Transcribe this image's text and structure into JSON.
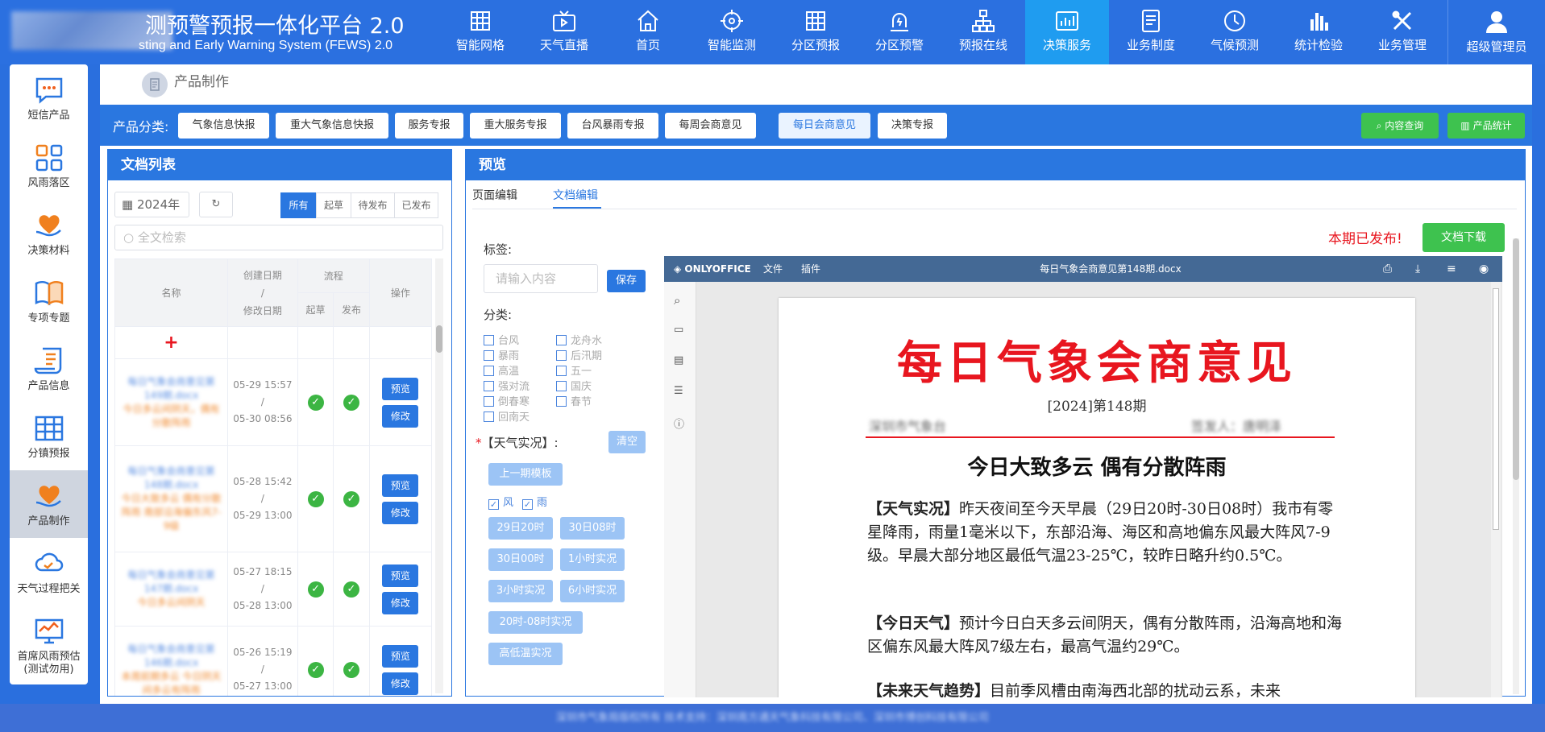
{
  "header": {
    "title": "测预警预报一体化平台 2.0",
    "subtitle": "sting and Early Warning System (FEWS) 2.0",
    "nav": [
      {
        "label": "智能网格",
        "icon": "grid-icon"
      },
      {
        "label": "天气直播",
        "icon": "video-icon"
      },
      {
        "label": "首页",
        "icon": "home-icon"
      },
      {
        "label": "智能监测",
        "icon": "target-icon"
      },
      {
        "label": "分区预报",
        "icon": "grid-icon"
      },
      {
        "label": "分区预警",
        "icon": "alarm-icon"
      },
      {
        "label": "预报在线",
        "icon": "org-icon"
      },
      {
        "label": "决策服务",
        "icon": "chart-icon"
      },
      {
        "label": "业务制度",
        "icon": "document-icon"
      },
      {
        "label": "气候预测",
        "icon": "clock-icon"
      },
      {
        "label": "统计检验",
        "icon": "bar-icon"
      },
      {
        "label": "业务管理",
        "icon": "tools-icon"
      }
    ],
    "user": "超级管理员"
  },
  "sidebar": [
    {
      "label": "短信产品",
      "icon": "message-icon"
    },
    {
      "label": "风雨落区",
      "icon": "apps-icon"
    },
    {
      "label": "决策材料",
      "icon": "heart-hand-icon"
    },
    {
      "label": "专项专题",
      "icon": "book-icon"
    },
    {
      "label": "产品信息",
      "icon": "scroll-icon"
    },
    {
      "label": "分镇预报",
      "icon": "table-icon"
    },
    {
      "label": "产品制作",
      "icon": "heart-hand-icon"
    },
    {
      "label": "天气过程把关",
      "icon": "cloud-icon"
    },
    {
      "label": "首席风雨预估",
      "label2": "(测试勿用)",
      "icon": "monitor-icon"
    }
  ],
  "breadcrumb": "产品制作",
  "categories": {
    "label": "产品分类:",
    "items": [
      "气象信息快报",
      "重大气象信息快报",
      "服务专报",
      "重大服务专报",
      "台风暴雨专报",
      "每周会商意见",
      "每日会商意见",
      "决策专报"
    ],
    "selected": "每日会商意见",
    "actions": [
      "内容查询",
      "产品统计"
    ]
  },
  "doclist": {
    "title": "文档列表",
    "year": "2024年",
    "search_placeholder": "全文检索",
    "filters": [
      "所有",
      "起草",
      "待发布",
      "已发布"
    ],
    "columns": {
      "name": "名称",
      "created": "创建日期",
      "sep": "/",
      "modified": "修改日期",
      "flow": "流程",
      "draft": "起草",
      "publish": "发布",
      "ops": "操作"
    },
    "add": "+",
    "rows": [
      {
        "name": "每日气象会商意见第149期.docx",
        "summary": "今日多云间阴天，偶有分散阵雨",
        "created": "05-29 15:57",
        "modified": "05-30 08:56"
      },
      {
        "name": "每日气象会商意见第148期.docx",
        "summary": "今日大致多云 偶有分散阵雨 南部沿海偏东风7-9级",
        "created": "05-28 15:42",
        "modified": "05-29 13:00"
      },
      {
        "name": "每日气象会商意见第147期.docx",
        "summary": "今日多云间阴天",
        "created": "05-27 18:15",
        "modified": "05-28 13:00"
      },
      {
        "name": "每日气象会商意见第146期.docx",
        "summary": "本周前期多云 今日阴天间多云有阵雨",
        "created": "05-26 15:19",
        "modified": "05-27 13:00"
      }
    ],
    "preview": "预览",
    "edit": "修改"
  },
  "preview": {
    "title": "预览",
    "tabs": [
      "页面编辑",
      "文档编辑"
    ],
    "status": "本期已发布!",
    "download": "文档下载",
    "tag_label": "标签:",
    "tag_placeholder": "请输入内容",
    "save": "保存",
    "cat_label": "分类:",
    "cat_left": [
      "台风",
      "暴雨",
      "高温",
      "强对流",
      "倒春寒",
      "回南天"
    ],
    "cat_right": [
      "龙舟水",
      "后汛期",
      "五一",
      "国庆",
      "春节"
    ],
    "weather_label": "【天气实况】:",
    "required": "*",
    "clear": "清空",
    "template": "上一期模板",
    "wind": "风",
    "rain": "雨",
    "times": [
      "29日20时",
      "30日08时",
      "30日00时",
      "1小时实况",
      "3小时实况",
      "6小时实况",
      "20时-08时实况",
      "高低温实况"
    ]
  },
  "onlyoffice": {
    "brand": "ONLYOFFICE",
    "menu": [
      "文件",
      "插件"
    ],
    "filename": "每日气象会商意见第148期.docx",
    "doc": {
      "title": "每日气象会商意见",
      "issue": "[2024]第148期",
      "org": "深圳市气象台",
      "signer": "签发人：唐明泽",
      "headline": "今日大致多云 偶有分散阵雨",
      "p1_label": "【天气实况】",
      "p1": "昨天夜间至今天早晨（29日20时-30日08时）我市有零星降雨，雨量1毫米以下，东部沿海、海区和高地偏东风最大阵风7-9级。早晨大部分地区最低气温23-25℃，较昨日略升约0.5℃。",
      "p2_label": "【今日天气】",
      "p2": "预计今日白天多云间阴天，偶有分散阵雨，沿海高地和海区偏东风最大阵风7级左右，最高气温约29℃。",
      "p3_label": "【未来天气趋势】",
      "p3": "目前季风槽由南海西北部的扰动云系，未来"
    }
  },
  "footer": "深圳市气象局版权所有    技术支持：深圳南方通天气象科技有限公司、深圳市博创科技有限公司",
  "colors": {
    "primary": "#2a77e0",
    "green": "#3ec24f",
    "red": "#e8161f"
  }
}
